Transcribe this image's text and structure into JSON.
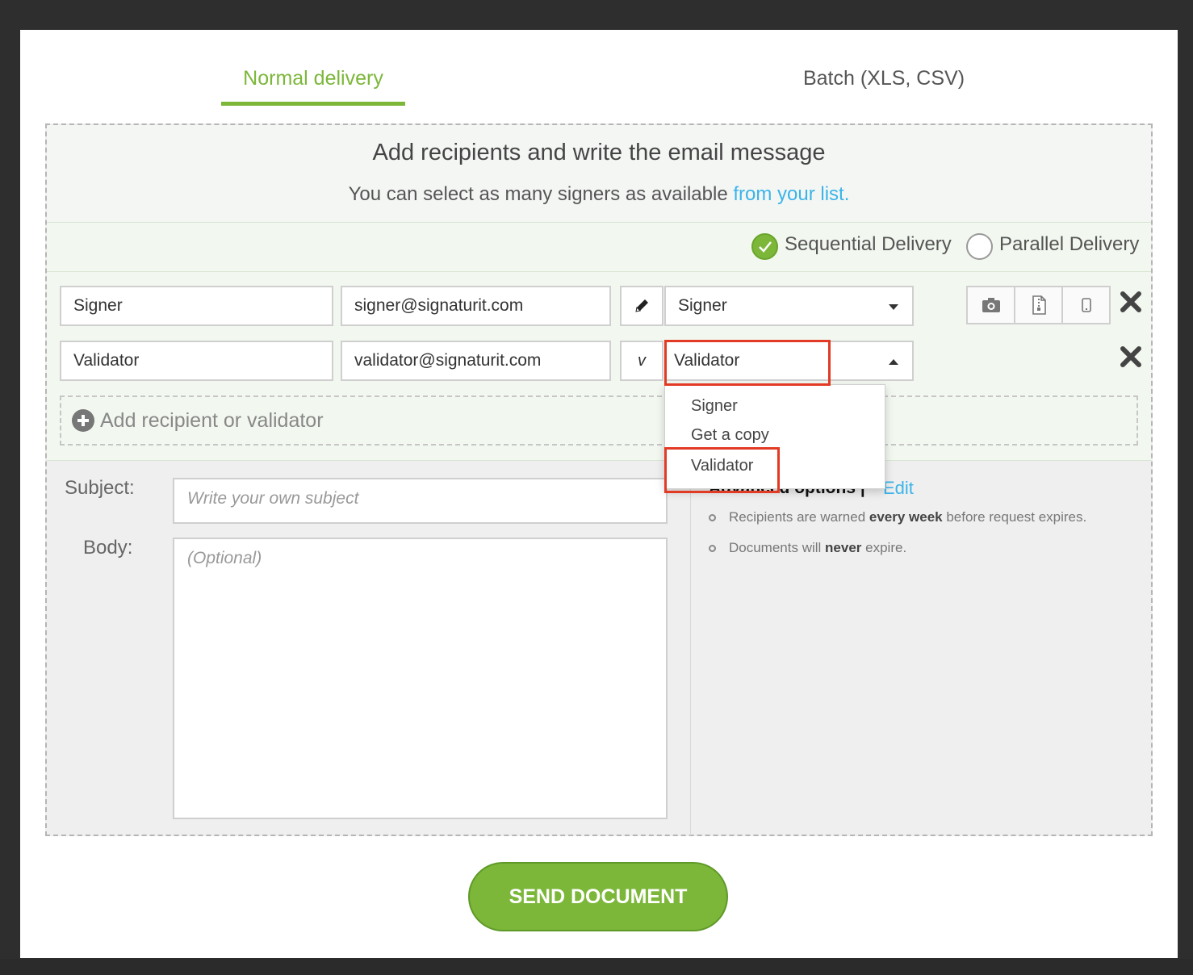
{
  "tabs": {
    "normal": "Normal delivery",
    "batch": "Batch (XLS, CSV)"
  },
  "header": {
    "title": "Add recipients and write the email message",
    "subtitle_text": "You can select as many signers as available",
    "subtitle_link": "from your list."
  },
  "delivery": {
    "sequential": "Sequential Delivery",
    "parallel": "Parallel Delivery",
    "selected": "sequential"
  },
  "recipients": [
    {
      "name": "Signer",
      "email": "signer@signaturit.com",
      "type_button": "✎",
      "role": "Signer"
    },
    {
      "name": "Validator",
      "email": "validator@signaturit.com",
      "type_button": "v",
      "role": "Validator"
    }
  ],
  "add_recipient": "Add recipient or validator",
  "role_dropdown": {
    "options": [
      "Signer",
      "Get a copy",
      "Validator"
    ],
    "open": true
  },
  "message": {
    "subject_label": "Subject:",
    "subject_placeholder": "Write your own subject",
    "body_label": "Body:",
    "body_placeholder": "(Optional)"
  },
  "advanced": {
    "title": "Advanced options |",
    "edit": "Edit",
    "line1_pre": "Recipients are warned ",
    "line1_bold": "every week",
    "line1_post": " before request expires.",
    "line2_pre": "Documents will ",
    "line2_bold": "never",
    "line2_post": " expire."
  },
  "send_button": "SEND DOCUMENT",
  "colors": {
    "accent_green": "#7cb73a",
    "link_blue": "#3bb4e8",
    "highlight_red": "#e23a24"
  }
}
